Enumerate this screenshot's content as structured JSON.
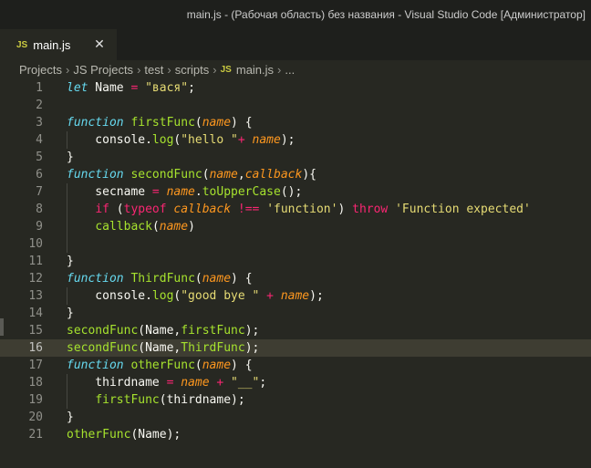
{
  "window": {
    "title": "main.js - (Рабочая область) без названия - Visual Studio Code [Администратор]"
  },
  "tab": {
    "badge": "JS",
    "label": "main.js",
    "close": "✕"
  },
  "breadcrumb": {
    "items": [
      "Projects",
      "JS Projects",
      "test",
      "scripts"
    ],
    "file_badge": "JS",
    "file": "main.js",
    "more": "...",
    "sep": "›"
  },
  "editor": {
    "active_line": 16,
    "lines": [
      {
        "n": "1",
        "tokens": [
          [
            "kw",
            "let"
          ],
          [
            "plain",
            " Name "
          ],
          [
            "op",
            "="
          ],
          [
            "plain",
            " "
          ],
          [
            "str",
            "\"вася\""
          ],
          [
            "plain",
            ";"
          ]
        ]
      },
      {
        "n": "2",
        "tokens": []
      },
      {
        "n": "3",
        "tokens": [
          [
            "kw",
            "function"
          ],
          [
            "plain",
            " "
          ],
          [
            "fn",
            "firstFunc"
          ],
          [
            "plain",
            "("
          ],
          [
            "param",
            "name"
          ],
          [
            "plain",
            ") {"
          ]
        ]
      },
      {
        "n": "4",
        "tokens": [
          [
            "plain",
            "    console."
          ],
          [
            "fn",
            "log"
          ],
          [
            "plain",
            "("
          ],
          [
            "str",
            "\"hello \""
          ],
          [
            "op",
            "+"
          ],
          [
            "plain",
            " "
          ],
          [
            "param",
            "name"
          ],
          [
            "plain",
            ");"
          ]
        ]
      },
      {
        "n": "5",
        "tokens": [
          [
            "plain",
            "}"
          ]
        ]
      },
      {
        "n": "6",
        "tokens": [
          [
            "kw",
            "function"
          ],
          [
            "plain",
            " "
          ],
          [
            "fn",
            "secondFunc"
          ],
          [
            "plain",
            "("
          ],
          [
            "param",
            "name"
          ],
          [
            "plain",
            ","
          ],
          [
            "param",
            "callback"
          ],
          [
            "plain",
            "){"
          ]
        ]
      },
      {
        "n": "7",
        "tokens": [
          [
            "plain",
            "    secname "
          ],
          [
            "op",
            "="
          ],
          [
            "plain",
            " "
          ],
          [
            "param",
            "name"
          ],
          [
            "plain",
            "."
          ],
          [
            "fn",
            "toUpperCase"
          ],
          [
            "plain",
            "();"
          ]
        ]
      },
      {
        "n": "8",
        "tokens": [
          [
            "plain",
            "    "
          ],
          [
            "kw2",
            "if"
          ],
          [
            "plain",
            " ("
          ],
          [
            "kw2",
            "typeof"
          ],
          [
            "plain",
            " "
          ],
          [
            "param",
            "callback"
          ],
          [
            "plain",
            " "
          ],
          [
            "op",
            "!=="
          ],
          [
            "plain",
            " "
          ],
          [
            "str",
            "'function'"
          ],
          [
            "plain",
            ") "
          ],
          [
            "kw2",
            "throw"
          ],
          [
            "plain",
            " "
          ],
          [
            "str",
            "'Function expected'"
          ]
        ]
      },
      {
        "n": "9",
        "tokens": [
          [
            "plain",
            "    "
          ],
          [
            "fn",
            "callback"
          ],
          [
            "plain",
            "("
          ],
          [
            "param",
            "name"
          ],
          [
            "plain",
            ")"
          ]
        ]
      },
      {
        "n": "10",
        "tokens": []
      },
      {
        "n": "11",
        "tokens": [
          [
            "plain",
            "}"
          ]
        ]
      },
      {
        "n": "12",
        "tokens": [
          [
            "kw",
            "function"
          ],
          [
            "plain",
            " "
          ],
          [
            "fn",
            "ThirdFunc"
          ],
          [
            "plain",
            "("
          ],
          [
            "param",
            "name"
          ],
          [
            "plain",
            ") {"
          ]
        ]
      },
      {
        "n": "13",
        "tokens": [
          [
            "plain",
            "    console."
          ],
          [
            "fn",
            "log"
          ],
          [
            "plain",
            "("
          ],
          [
            "str",
            "\"good bye \""
          ],
          [
            "plain",
            " "
          ],
          [
            "op",
            "+"
          ],
          [
            "plain",
            " "
          ],
          [
            "param",
            "name"
          ],
          [
            "plain",
            ");"
          ]
        ]
      },
      {
        "n": "14",
        "tokens": [
          [
            "plain",
            "}"
          ]
        ]
      },
      {
        "n": "15",
        "tokens": [
          [
            "fn",
            "secondFunc"
          ],
          [
            "plain",
            "(Name,"
          ],
          [
            "fn",
            "firstFunc"
          ],
          [
            "plain",
            ");"
          ]
        ]
      },
      {
        "n": "16",
        "tokens": [
          [
            "fn",
            "secondFunc"
          ],
          [
            "plain",
            "(Name,"
          ],
          [
            "fn",
            "ThirdFunc"
          ],
          [
            "plain",
            ");"
          ]
        ]
      },
      {
        "n": "17",
        "tokens": [
          [
            "kw",
            "function"
          ],
          [
            "plain",
            " "
          ],
          [
            "fn",
            "otherFunc"
          ],
          [
            "plain",
            "("
          ],
          [
            "param",
            "name"
          ],
          [
            "plain",
            ") {"
          ]
        ]
      },
      {
        "n": "18",
        "tokens": [
          [
            "plain",
            "    thirdname "
          ],
          [
            "op",
            "="
          ],
          [
            "plain",
            " "
          ],
          [
            "param",
            "name"
          ],
          [
            "plain",
            " "
          ],
          [
            "op",
            "+"
          ],
          [
            "plain",
            " "
          ],
          [
            "str",
            "\"__\""
          ],
          [
            "plain",
            ";"
          ]
        ]
      },
      {
        "n": "19",
        "tokens": [
          [
            "plain",
            "    "
          ],
          [
            "fn",
            "firstFunc"
          ],
          [
            "plain",
            "(thirdname);"
          ]
        ]
      },
      {
        "n": "20",
        "tokens": [
          [
            "plain",
            "}"
          ]
        ]
      },
      {
        "n": "21",
        "tokens": [
          [
            "fn",
            "otherFunc"
          ],
          [
            "plain",
            "(Name);"
          ]
        ]
      }
    ]
  },
  "colors": {
    "background": "#272822",
    "keyword_storage": "#66d9ef",
    "keyword_control": "#f92672",
    "function": "#a6e22e",
    "parameter": "#fd971f",
    "string": "#e6db74"
  }
}
